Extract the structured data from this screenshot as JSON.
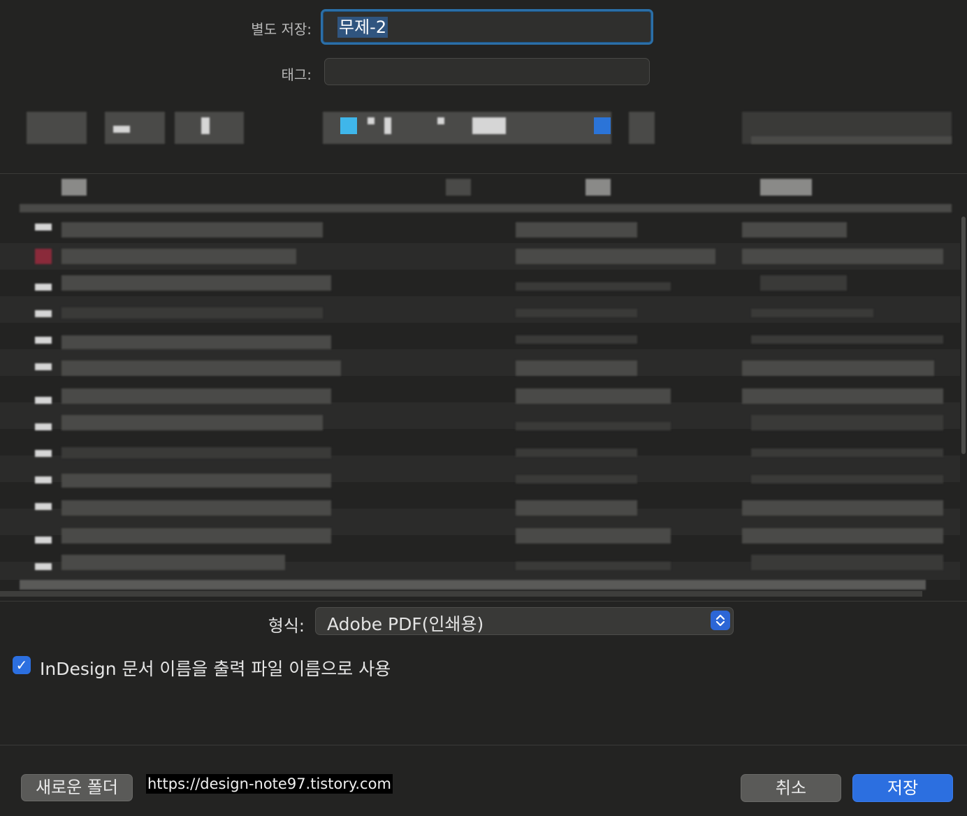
{
  "save_as": {
    "label": "별도 저장:",
    "value": "무제-2"
  },
  "tags": {
    "label": "태그:",
    "value": ""
  },
  "format": {
    "label": "형식:",
    "value": "Adobe PDF(인쇄용)",
    "stepper_icon": "chevron-up-down-icon"
  },
  "option": {
    "checked": true,
    "label": "InDesign 문서 이름을 출력 파일 이름으로 사용"
  },
  "footer": {
    "new_folder_label": "새로운 폴더",
    "watermark": "https://design-note97.tistory.com",
    "cancel_label": "취소",
    "save_label": "저장"
  },
  "colors": {
    "accent": "#2c6fe0",
    "background": "#232322",
    "selection": "#30557f"
  }
}
